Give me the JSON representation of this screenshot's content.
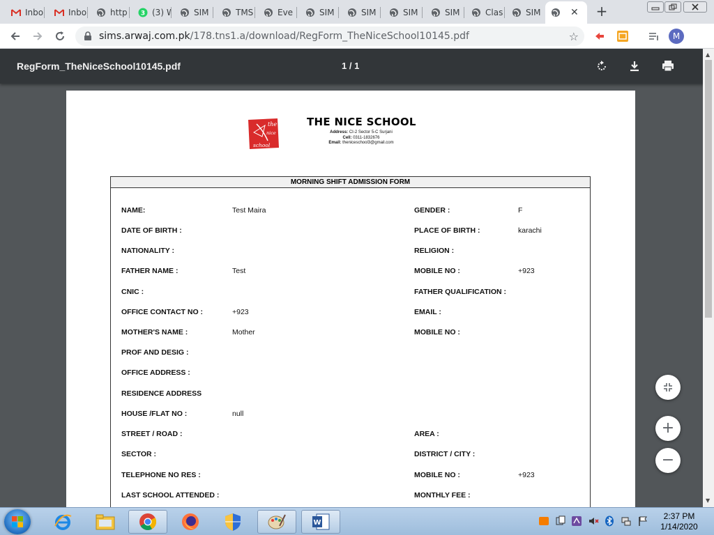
{
  "browser": {
    "tabs": [
      {
        "label": "Inbo",
        "icon": "gmail-icon"
      },
      {
        "label": "Inbo",
        "icon": "gmail-icon"
      },
      {
        "label": "http",
        "icon": "globe-icon"
      },
      {
        "label": "(3) W",
        "icon": "whatsapp-icon",
        "badge": "3"
      },
      {
        "label": "SIM",
        "icon": "globe-icon"
      },
      {
        "label": "TMS",
        "icon": "globe-icon"
      },
      {
        "label": "Eve",
        "icon": "globe-icon"
      },
      {
        "label": "SIM",
        "icon": "globe-icon"
      },
      {
        "label": "SIM",
        "icon": "globe-icon"
      },
      {
        "label": "SIM",
        "icon": "globe-icon"
      },
      {
        "label": "SIM",
        "icon": "globe-icon"
      },
      {
        "label": "Clas",
        "icon": "globe-icon"
      },
      {
        "label": "SIM",
        "icon": "globe-icon"
      },
      {
        "label": "",
        "icon": "globe-icon",
        "active": true
      }
    ],
    "new_tab": "+",
    "url_host": "sims.arwaj.com.pk",
    "url_path": "/178.tns1.a/download/RegForm_TheNiceSchool10145.pdf",
    "profile_initial": "M"
  },
  "pdf_viewer": {
    "file_name": "RegForm_TheNiceSchool10145.pdf",
    "page_indicator": "1 / 1"
  },
  "document": {
    "school_name": "THE NICE SCHOOL",
    "logo_text": [
      "the",
      "nice",
      "school"
    ],
    "address_label": "Address:",
    "address": "CI-2 Sector 5-C Surjani",
    "cell_label": "Cell:",
    "cell": "0311-1832676",
    "email_label": "Email:",
    "email": "theniceschool3@gmail.com",
    "form_title": "MORNING SHIFT ADMISSION FORM",
    "fields": {
      "name_label": "NAME:",
      "name": "Test Maira",
      "gender_label": "GENDER :",
      "gender": "F",
      "dob_label": "DATE OF BIRTH :",
      "pob_label": "PLACE OF BIRTH :",
      "pob": "karachi",
      "nationality_label": "NATIONALITY :",
      "religion_label": "RELIGION :",
      "father_name_label": "FATHER NAME :",
      "father_name": "Test",
      "mobile1_label": "MOBILE NO :",
      "mobile1": "+923",
      "cnic_label": "CNIC :",
      "father_qual_label": "FATHER QUALIFICATION :",
      "office_contact_label": "OFFICE CONTACT NO :",
      "office_contact": "+923",
      "email_label": "EMAIL :",
      "mother_name_label": "MOTHER'S NAME :",
      "mother_name": "Mother",
      "mobile2_label": "MOBILE NO :",
      "prof_label": "PROF AND DESIG :",
      "office_address_label": "OFFICE ADDRESS :",
      "residence_label": "RESIDENCE ADDRESS",
      "house_label": "HOUSE /FLAT NO :",
      "house": "null",
      "street_label": "STREET / ROAD :",
      "area_label": "AREA :",
      "sector_label": "SECTOR :",
      "district_label": "DISTRICT / CITY :",
      "telephone_label": "TELEPHONE NO RES :",
      "mobile3_label": "MOBILE NO :",
      "mobile3": "+923",
      "last_school_label": "LAST SCHOOL ATTENDED :",
      "monthly_fee_label": "MONTHLY FEE :"
    }
  },
  "zoom_controls": {
    "fit": "fit-to-page-icon",
    "zoom_in": "+",
    "zoom_out": "−"
  },
  "taskbar": {
    "time": "2:37 PM",
    "date": "1/14/2020"
  },
  "colors": {
    "accent_red": "#d92b2b",
    "pdf_toolbar": "#323639",
    "viewer_bg": "#525659"
  }
}
